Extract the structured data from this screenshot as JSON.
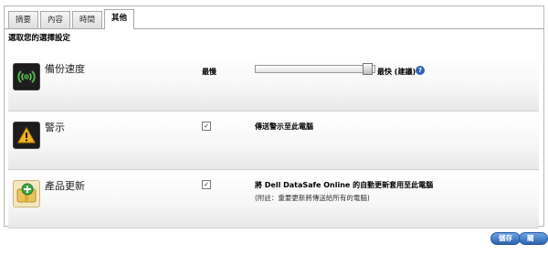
{
  "tabs": [
    {
      "label": "摘要"
    },
    {
      "label": "內容"
    },
    {
      "label": "時間"
    },
    {
      "label": "其他",
      "active": true
    }
  ],
  "section_heading": "選取您的選擇設定",
  "backup_speed": {
    "title": "備份速度",
    "min_label": "最慢",
    "max_label": "最快 (建議)",
    "help_icon": "question-icon",
    "level": 0.92
  },
  "alerts": {
    "title": "警示",
    "checkbox_checked": true,
    "checkbox_label": "傳送警示至此電腦"
  },
  "product_updates": {
    "title": "產品更新",
    "checkbox_checked": true,
    "checkbox_label": "將 Dell DataSafe Online 的自動更新套用至此電腦",
    "note": "(附註：重要更新將傳送給所有的電腦)"
  },
  "buttons": {
    "save": "儲存",
    "close": "關閉"
  },
  "colors": {
    "accent": "#2f63b0"
  }
}
